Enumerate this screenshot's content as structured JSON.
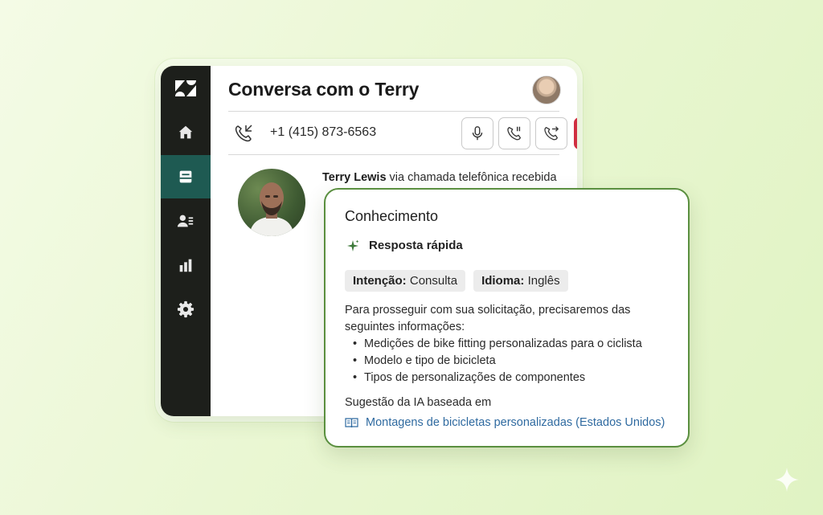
{
  "conversation": {
    "title": "Conversa com o Terry",
    "phone_number": "+1 (415) 873-6563",
    "caller_name": "Terry Lewis",
    "caller_suffix": " via chamada telefônica recebida"
  },
  "sidebar": {
    "items": [
      {
        "icon": "home-icon"
      },
      {
        "icon": "inbox-icon",
        "active": true
      },
      {
        "icon": "contacts-icon"
      },
      {
        "icon": "reports-icon"
      },
      {
        "icon": "gear-icon"
      }
    ]
  },
  "call_controls": [
    "microphone-icon",
    "hold-call-icon",
    "transfer-call-icon",
    "end-call-icon"
  ],
  "knowledge": {
    "title": "Conhecimento",
    "quick_answer": "Resposta rápida",
    "intent_label": "Intenção:",
    "intent_value": " Consulta",
    "language_label": "Idioma:",
    "language_value": " Inglês",
    "intro": "Para prosseguir com sua solicitação, precisaremos das seguintes informações:",
    "bullets": [
      "Medições de bike fitting personalizadas para o ciclista",
      "Modelo e tipo de bicicleta",
      "Tipos de personalizações de componentes"
    ],
    "suggestion_label": "Sugestão da IA baseada em",
    "source_link": "Montagens de bicicletas personalizadas (Estados Unidos)"
  },
  "colors": {
    "sidebar": "#1d1f1b",
    "active_nav": "#1e5a52",
    "end_call": "#d02f41",
    "card_border": "#5a8f3f",
    "link": "#2f6aa0"
  }
}
